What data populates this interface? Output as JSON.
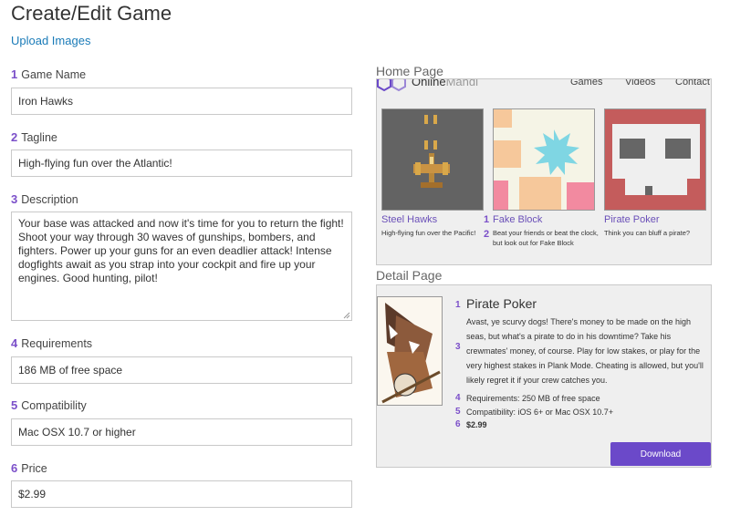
{
  "page_title": "Create/Edit Game",
  "upload_link": "Upload Images",
  "form": {
    "game_name": {
      "num": "1",
      "label": "Game Name",
      "value": "Iron Hawks"
    },
    "tagline": {
      "num": "2",
      "label": "Tagline",
      "value": "High-flying fun over the Atlantic!"
    },
    "description": {
      "num": "3",
      "label": "Description",
      "value": "Your base was attacked and now it's time for you to return the fight! Shoot your way through 30 waves of gunships, bombers, and fighters. Power up your guns for an even deadlier attack! Intense dogfights await as you strap into your cockpit and fire up your engines. Good hunting, pilot!"
    },
    "requirements": {
      "num": "4",
      "label": "Requirements",
      "value": "186 MB of free space"
    },
    "compatibility": {
      "num": "5",
      "label": "Compatibility",
      "value": "Mac OSX 10.7 or higher"
    },
    "price": {
      "num": "6",
      "label": "Price",
      "value": "$2.99"
    }
  },
  "home_preview": {
    "section_title": "Home Page",
    "brand_main": "Online",
    "brand_sub": "Mandi",
    "nav": [
      "Games",
      "Videos",
      "Contact"
    ],
    "cards": [
      {
        "title": "Steel Hawks",
        "tagline": "High-flying fun over the Pacific!"
      },
      {
        "num_title": "1",
        "num_tag": "2",
        "title": "Fake Block",
        "tagline": "Beat your friends or beat the clock, but look out for Fake Block"
      },
      {
        "title": "Pirate Poker",
        "tagline": "Think you can bluff a pirate?"
      }
    ]
  },
  "detail_preview": {
    "section_title": "Detail Page",
    "num_title": "1",
    "title": "Pirate Poker",
    "num_desc": "3",
    "description": "Avast, ye scurvy dogs! There's money to be made on the high seas, but what's a pirate to do in his downtime? Take his crewmates' money, of course. Play for low stakes, or play for the very highest stakes in Plank Mode. Cheating is allowed, but you'll likely regret it if your crew catches you.",
    "num_req": "4",
    "requirements": "Requirements: 250 MB of free space",
    "num_compat": "5",
    "compatibility": "Compatibility: iOS 6+ or Mac OSX 10.7+",
    "num_price": "6",
    "price": "$2.99",
    "download_label": "Download"
  },
  "colors": {
    "accent": "#7b4fc9",
    "link": "#1a7bb8",
    "button": "#6b49c9"
  }
}
